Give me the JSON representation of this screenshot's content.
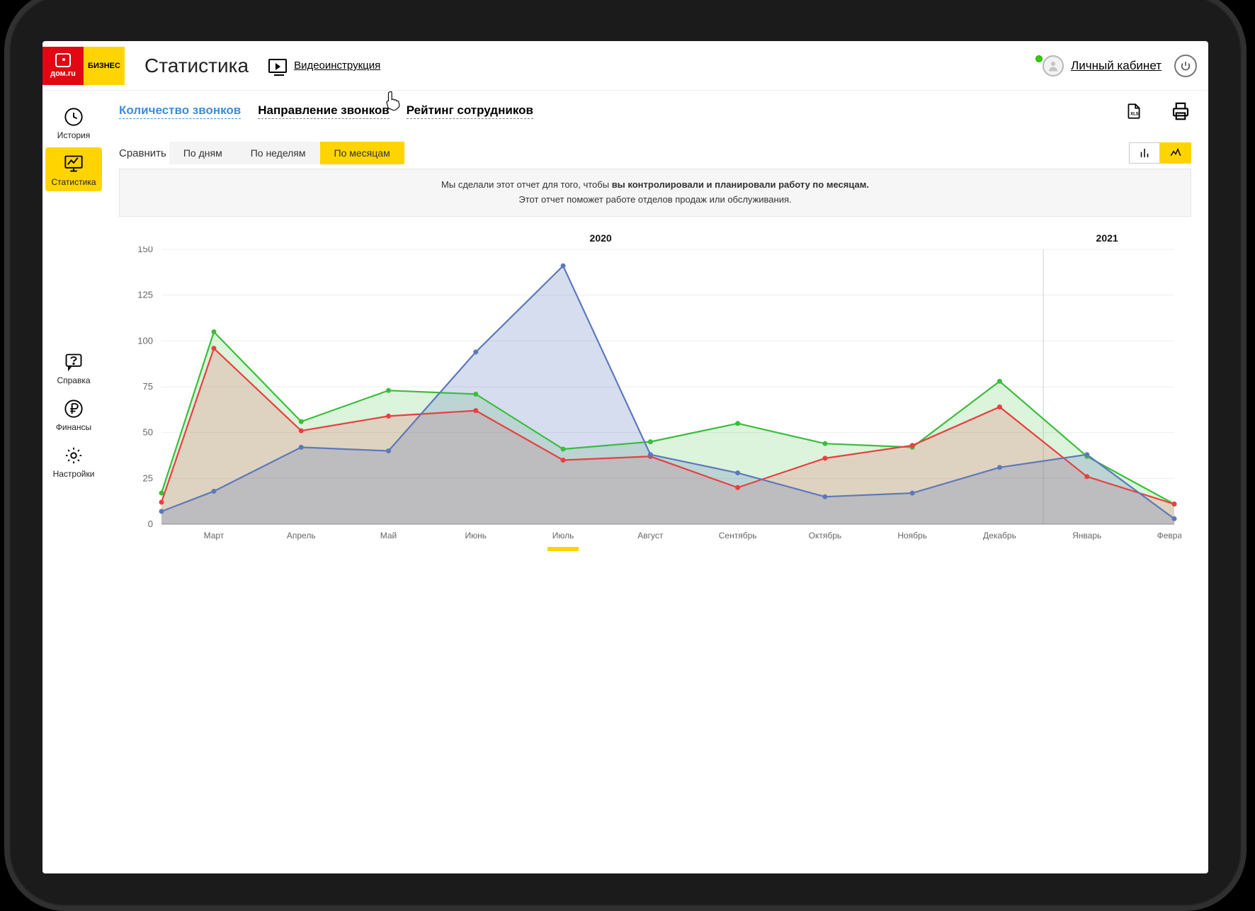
{
  "brand": {
    "red_label": "дом.ru",
    "yellow_label": "БИЗНЕС"
  },
  "header": {
    "page_title": "Статистика",
    "video_instruction": "Видеоинструкция",
    "account_label": "Личный кабинет"
  },
  "sidebar": {
    "history": "История",
    "stats": "Статистика",
    "help": "Справка",
    "finance": "Финансы",
    "settings": "Настройки"
  },
  "tabs": {
    "calls_count": "Количество звонков",
    "calls_direction": "Направление звонков",
    "employee_rating": "Рейтинг сотрудников"
  },
  "compare": {
    "label": "Сравнить",
    "by_days": "По дням",
    "by_weeks": "По неделям",
    "by_months": "По месяцам"
  },
  "banner": {
    "line1_a": "Мы сделали этот отчет для того, чтобы ",
    "line1_b": "вы контролировали и планировали работу по месяцам.",
    "line2": "Этот отчет поможет работе отделов продаж или обслуживания."
  },
  "years": {
    "y2020": "2020",
    "y2021": "2021"
  },
  "chart_data": {
    "type": "area",
    "categories": [
      "Март",
      "Апрель",
      "Май",
      "Июнь",
      "Июль",
      "Август",
      "Сентябрь",
      "Октябрь",
      "Ноябрь",
      "Декабрь",
      "Январь",
      "Февраль"
    ],
    "y_ticks": [
      0,
      25,
      50,
      75,
      100,
      125,
      150
    ],
    "ylim": [
      0,
      150
    ],
    "title": "",
    "xlabel": "",
    "ylabel": "",
    "start_points": {
      "green": 17,
      "red": 12,
      "blue": 7
    },
    "series": [
      {
        "name": "green",
        "color": "#3bbd3b",
        "fill": "rgba(59,189,59,0.18)",
        "values": [
          105,
          56,
          73,
          71,
          41,
          45,
          55,
          44,
          42,
          78,
          37,
          11
        ]
      },
      {
        "name": "red",
        "color": "#e74040",
        "fill": "rgba(231,64,64,0.18)",
        "values": [
          96,
          51,
          59,
          62,
          35,
          37,
          20,
          36,
          43,
          64,
          26,
          11
        ]
      },
      {
        "name": "blue",
        "color": "#5d79ba",
        "fill": "rgba(93,121,186,0.25)",
        "values": [
          18,
          42,
          40,
          94,
          141,
          38,
          28,
          15,
          17,
          31,
          38,
          3
        ]
      }
    ],
    "year_split_after_index": 9,
    "year_labels": {
      "left": "2020",
      "right": "2021"
    }
  },
  "colors": {
    "accent_yellow": "#ffd400",
    "brand_red": "#e30613",
    "link_blue": "#3a8dde"
  }
}
